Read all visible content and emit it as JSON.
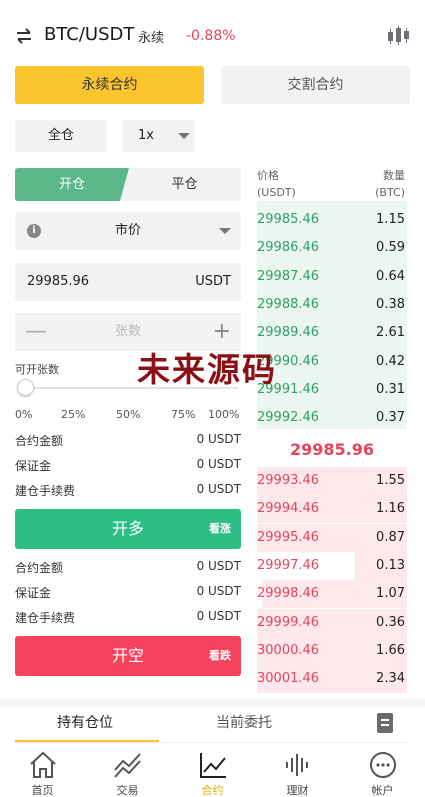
{
  "header": {
    "pair": "BTC/USDT",
    "type": "永续",
    "change": "-0.88%"
  },
  "tabs": {
    "perpetual": "永续合约",
    "delivery": "交割合约"
  },
  "margin_mode": "全仓",
  "leverage": "1x",
  "order_side": {
    "open": "开仓",
    "close": "平仓"
  },
  "order_type": "市价",
  "price_input": {
    "value": "29985.96",
    "unit": "USDT"
  },
  "qty_input": {
    "placeholder": "张数",
    "minus": "—",
    "plus": "+"
  },
  "available_label": "可开张数",
  "slider": {
    "value_pct": 0,
    "marks": [
      "0%",
      "25%",
      "50%",
      "75%",
      "100%"
    ]
  },
  "long_block": {
    "rows": [
      {
        "label": "合约金额",
        "value": "0 USDT"
      },
      {
        "label": "保证金",
        "value": "0 USDT"
      },
      {
        "label": "建仓手续费",
        "value": "0 USDT"
      }
    ],
    "button": "开多",
    "tag": "看涨"
  },
  "short_block": {
    "rows": [
      {
        "label": "合约金额",
        "value": "0 USDT"
      },
      {
        "label": "保证金",
        "value": "0 USDT"
      },
      {
        "label": "建仓手续费",
        "value": "0 USDT"
      }
    ],
    "button": "开空",
    "tag": "看跌"
  },
  "orderbook": {
    "header": {
      "price": "价格",
      "price_unit": "(USDT)",
      "qty": "数量",
      "qty_unit": "(BTC)"
    },
    "bids": [
      {
        "price": "29985.46",
        "qty": "1.15"
      },
      {
        "price": "29986.46",
        "qty": "0.59"
      },
      {
        "price": "29987.46",
        "qty": "0.64"
      },
      {
        "price": "29988.46",
        "qty": "0.38"
      },
      {
        "price": "29989.46",
        "qty": "2.61"
      },
      {
        "price": "29990.46",
        "qty": "0.42"
      },
      {
        "price": "29991.46",
        "qty": "0.31"
      },
      {
        "price": "29992.46",
        "qty": "0.37"
      }
    ],
    "mid_price": "29985.96",
    "asks": [
      {
        "price": "29993.46",
        "qty": "1.55",
        "depth": 1.0
      },
      {
        "price": "29994.46",
        "qty": "1.16",
        "depth": 1.0
      },
      {
        "price": "29995.46",
        "qty": "0.87",
        "depth": 1.0
      },
      {
        "price": "29997.46",
        "qty": "0.13",
        "depth": 0.35
      },
      {
        "price": "29998.46",
        "qty": "1.07",
        "depth": 0.97
      },
      {
        "price": "29999.46",
        "qty": "0.36",
        "depth": 1.0
      },
      {
        "price": "30000.46",
        "qty": "1.66",
        "depth": 1.0
      },
      {
        "price": "30001.46",
        "qty": "2.34",
        "depth": 1.0
      }
    ]
  },
  "watermark": "未来源码",
  "bottom_tabs": {
    "positions": "持有仓位",
    "orders": "当前委托"
  },
  "nav": [
    {
      "label": "首页",
      "icon": "home-icon"
    },
    {
      "label": "交易",
      "icon": "trade-icon"
    },
    {
      "label": "合约",
      "icon": "contract-icon"
    },
    {
      "label": "理财",
      "icon": "finance-icon"
    },
    {
      "label": "帐户",
      "icon": "account-icon"
    }
  ],
  "colors": {
    "accent": "#fcc42d",
    "up": "#2ebd85",
    "down": "#f5435e",
    "bid_text": "#2e9e6e",
    "ask_text": "#e8435c"
  }
}
